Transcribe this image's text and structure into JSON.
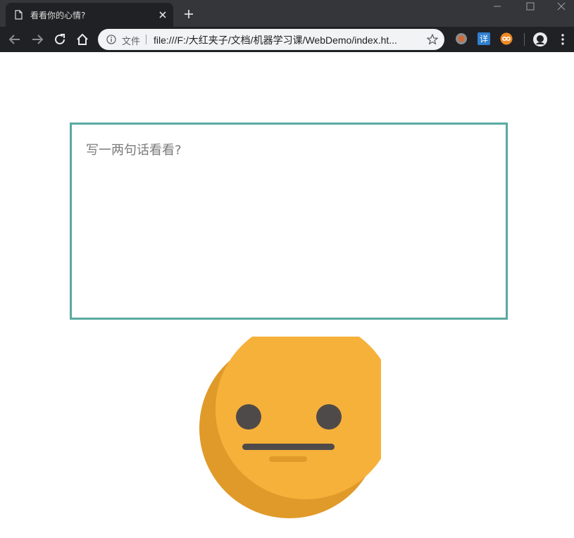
{
  "browser": {
    "tab_title": "看看你的心情?",
    "scheme_label": "文件",
    "url": "file:///F:/大红夹子/文档/机器学习课/WebDemo/index.ht...",
    "extensions": [
      "record-extension-icon",
      "translate-extension-icon",
      "infinity-extension-icon"
    ],
    "translate_glyph": "详"
  },
  "page": {
    "input_placeholder": "写一两句话看看?",
    "input_value": "",
    "mood": "neutral",
    "colors": {
      "input_border": "#5aa9a0",
      "face": "#f6b13a",
      "face_shadow": "#e09a2a",
      "features": "#4f4a4a"
    }
  }
}
